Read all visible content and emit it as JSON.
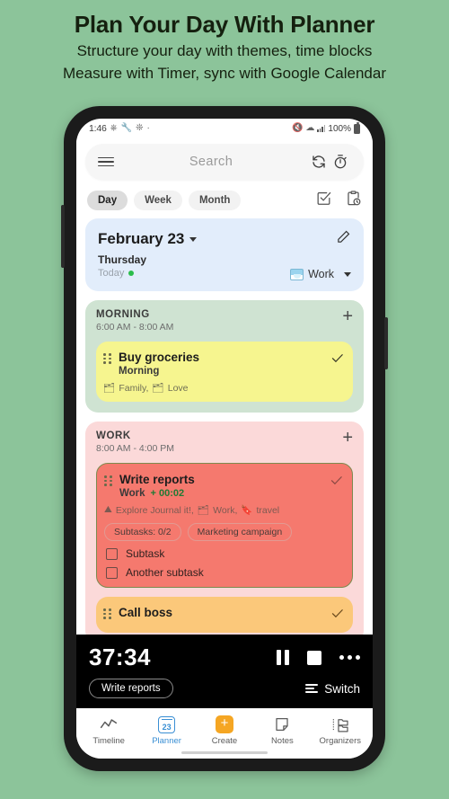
{
  "promo": {
    "title": "Plan Your Day With Planner",
    "subtitle_line1": "Structure your day with themes, time blocks",
    "subtitle_line2": "Measure with Timer, sync with Google Calendar",
    "background_color": "#8cc49a"
  },
  "status_bar": {
    "time": "1:46",
    "left_icons": [
      "headphones-icon",
      "wrench-icon",
      "fan-icon",
      "more-icon"
    ],
    "mute_icon": "mute-icon",
    "wifi_icon": "wifi-icon",
    "signal_icon": "signal-icon",
    "battery_percent": "100%",
    "battery_icon": "battery-icon"
  },
  "search": {
    "placeholder": "Search",
    "menu_icon": "hamburger-menu-icon",
    "sync_icon": "sync-refresh-icon",
    "timer_icon": "stopwatch-icon"
  },
  "view_tabs": {
    "items": [
      {
        "label": "Day",
        "active": true
      },
      {
        "label": "Week",
        "active": false
      },
      {
        "label": "Month",
        "active": false
      }
    ],
    "checkbox_icon": "checkbox-checked-icon",
    "clipboard_icon": "clipboard-clock-icon"
  },
  "date_card": {
    "title": "February 23",
    "caret_icon": "chevron-down-icon",
    "edit_icon": "pencil-edit-icon",
    "day_of_week": "Thursday",
    "today_label": "Today",
    "today_dot_color": "#2bbd4b",
    "theme_label": "Work",
    "theme_emoji": "face-with-mask-emoji",
    "theme_caret_icon": "chevron-down-icon",
    "background_color": "#e2edfb"
  },
  "groups": [
    {
      "name": "MORNING",
      "time_range": "6:00 AM - 8:00 AM",
      "background_color": "#cfe3d2",
      "add_icon": "plus-icon",
      "tasks": [
        {
          "title": "Buy groceries",
          "subtitle": "Morning",
          "timer": "",
          "tags": [
            "Family,",
            "Love"
          ],
          "tag_icon": "folder-tag-icon",
          "color": "#f6f58f",
          "check_icon": "check-icon",
          "grip_icon": "drag-handle-icon",
          "pills": [],
          "subtasks": []
        }
      ]
    },
    {
      "name": "WORK",
      "time_range": "8:00 AM - 4:00 PM",
      "background_color": "#fbd9d9",
      "add_icon": "plus-icon",
      "tasks": [
        {
          "title": "Write reports",
          "subtitle": "Work",
          "timer": "+ 00:02",
          "tags": [
            "Explore Journal it!,",
            "Work,",
            "travel"
          ],
          "tag_icon": "folder-tag-icon",
          "color": "#f5796e",
          "check_icon": "check-icon",
          "grip_icon": "drag-handle-icon",
          "pills": [
            "Subtasks: 0/2",
            "Marketing campaign"
          ],
          "subtasks": [
            {
              "label": "Subtask",
              "checked": false
            },
            {
              "label": "Another subtask",
              "checked": false
            }
          ]
        },
        {
          "title": "Call boss",
          "subtitle": "",
          "timer": "",
          "tags": [],
          "color": "#fbc87a",
          "check_icon": "check-icon",
          "grip_icon": "drag-handle-icon",
          "pills": [],
          "subtasks": []
        }
      ]
    }
  ],
  "timer_bar": {
    "elapsed": "37:34",
    "task_label": "Write reports",
    "switch_label": "Switch",
    "pause_icon": "pause-icon",
    "stop_icon": "stop-icon",
    "more_icon": "more-horizontal-icon",
    "switch_icon": "list-switch-icon",
    "background_color": "#000000"
  },
  "bottom_nav": {
    "items": [
      {
        "label": "Timeline",
        "icon": "timeline-chart-icon",
        "active": false
      },
      {
        "label": "Planner",
        "icon": "calendar-23-icon",
        "active": true
      },
      {
        "label": "Create",
        "icon": "plus-square-icon",
        "active": false
      },
      {
        "label": "Notes",
        "icon": "note-page-icon",
        "active": false
      },
      {
        "label": "Organizers",
        "icon": "folders-icon",
        "active": false
      }
    ],
    "calendar_day": "23",
    "active_color": "#3a8fd4",
    "create_color": "#f5a623"
  }
}
